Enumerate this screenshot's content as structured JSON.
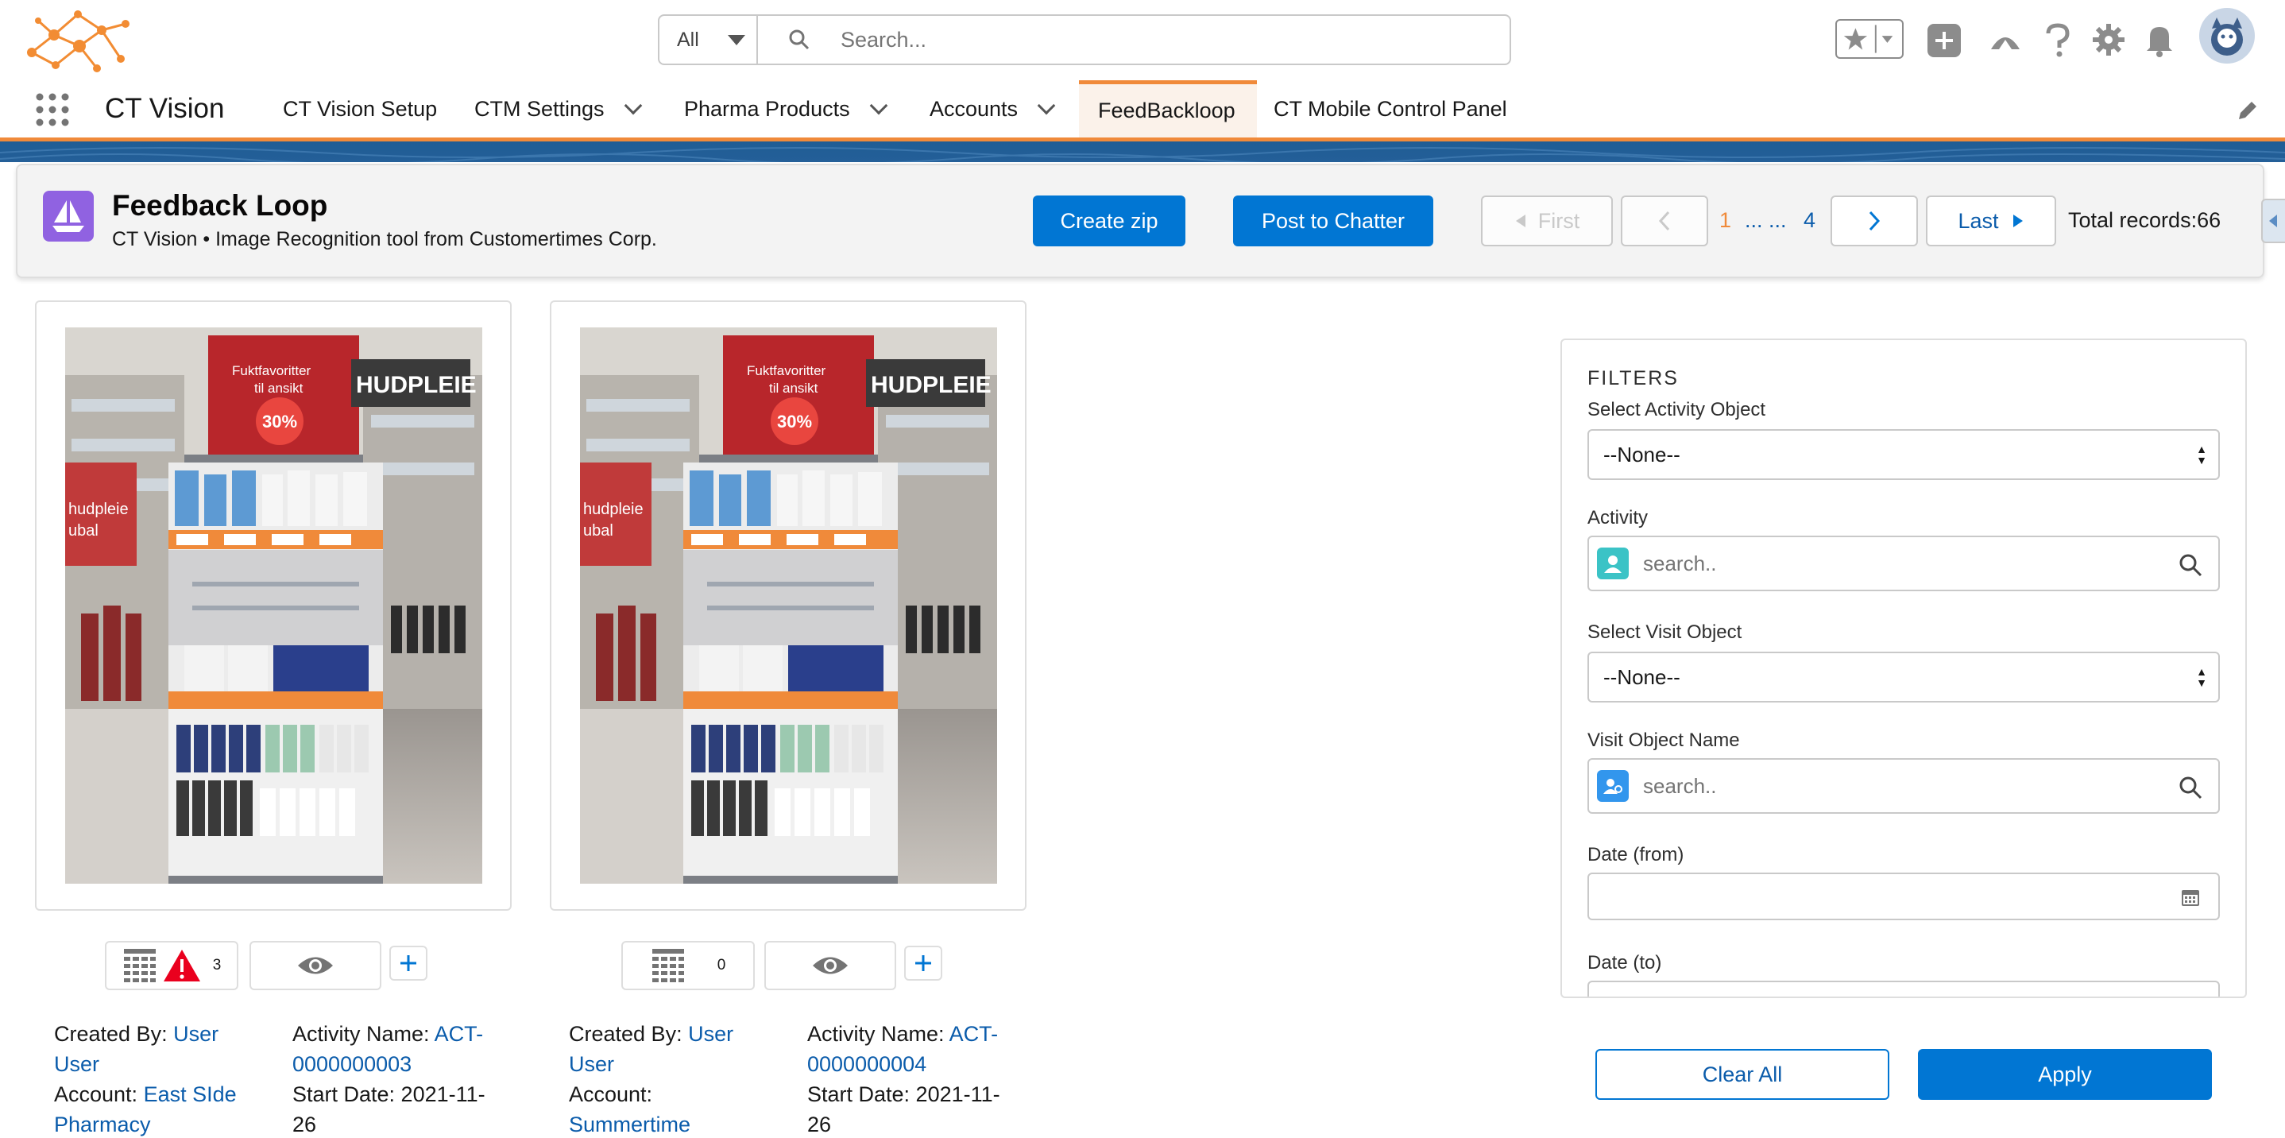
{
  "header": {
    "search_scope": "All",
    "search_placeholder": "Search..."
  },
  "nav": {
    "app_name": "CT Vision",
    "items": [
      {
        "label": "CT Vision Setup"
      },
      {
        "label": "CTM Settings"
      },
      {
        "label": "Pharma Products"
      },
      {
        "label": "Accounts"
      },
      {
        "label": "FeedBackloop"
      },
      {
        "label": "CT Mobile Control Panel"
      }
    ],
    "active_tab": "FeedBackloop"
  },
  "page": {
    "title": "Feedback Loop",
    "subtitle": "CT Vision • Image Recognition tool from Customertimes Corp.",
    "create_zip": "Create zip",
    "post_to_chatter": "Post to Chatter",
    "pagination": {
      "first": "First",
      "current": "1",
      "ellipsis": "... ...",
      "last_page": "4",
      "last": "Last",
      "total": "Total records:66"
    }
  },
  "cards": [
    {
      "warning_count": "3",
      "has_warning": true,
      "created_by_label": "Created By:",
      "created_by_line1": "User",
      "created_by_line2": "User",
      "account_label": "Account:",
      "account_inline": "East SIde",
      "account_line2": "Pharmacy",
      "activity_label": "Activity Name:",
      "activity_inline": "ACT-",
      "activity_line2": "0000000003",
      "start_date_line1": "Start Date: 2021-11-",
      "start_date_line2": "26"
    },
    {
      "warning_count": "0",
      "has_warning": false,
      "created_by_label": "Created By:",
      "created_by_line1": "User",
      "created_by_line2": "User",
      "account_label": "Account:",
      "account_inline": "",
      "account_line2": "Summertime",
      "activity_label": "Activity Name:",
      "activity_inline": "ACT-",
      "activity_line2": "0000000004",
      "start_date_line1": "Start Date: 2021-11-",
      "start_date_line2": "26"
    }
  ],
  "filters": {
    "heading": "FILTERS",
    "select_activity_object_label": "Select Activity Object",
    "select_activity_object_value": "--None--",
    "activity_label": "Activity",
    "activity_placeholder": "search..",
    "select_visit_object_label": "Select Visit Object",
    "select_visit_object_value": "--None--",
    "visit_object_name_label": "Visit Object Name",
    "visit_object_name_placeholder": "search..",
    "date_from_label": "Date (from)",
    "date_to_label": "Date (to)",
    "clear_all": "Clear All",
    "apply": "Apply"
  },
  "photo_text": {
    "banner": "Fuktfavoritter til ansikt",
    "percent": "30%",
    "brand": "HUDPLEIE",
    "side": "hudpleie ubal"
  },
  "colors": {
    "brand_blue": "#0176d3",
    "link_blue": "#0b5cab",
    "accent_orange": "#f08a3a",
    "app_icon_purple": "#9062e1",
    "stripe_blue": "#1f5d95",
    "warning_red": "#ea001e"
  }
}
